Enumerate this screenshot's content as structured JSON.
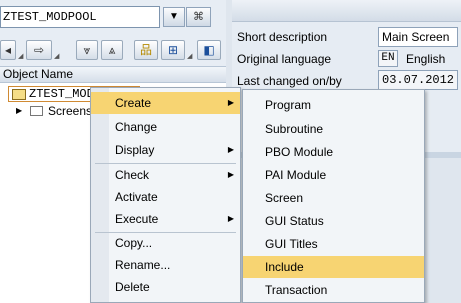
{
  "program": {
    "name": "ZTEST_MODPOOL"
  },
  "tree": {
    "header": "Object Name",
    "nodes": [
      {
        "label": "ZTEST_MODPOOL"
      },
      {
        "label": "Screens"
      }
    ]
  },
  "attributes": {
    "short_description_label": "Short description",
    "short_description_value": "Main Screen",
    "original_language_label": "Original language",
    "language_code": "EN",
    "language_name": "English",
    "last_changed_label": "Last changed on/by",
    "last_changed_date": "03.07.2012"
  },
  "context_menu": {
    "items": [
      {
        "label": "Create",
        "has_submenu": true
      },
      {
        "label": "Change"
      },
      {
        "label": "Display",
        "has_submenu": true
      },
      {
        "label": "Check",
        "has_submenu": true
      },
      {
        "label": "Activate"
      },
      {
        "label": "Execute",
        "has_submenu": true
      },
      {
        "label": "Copy..."
      },
      {
        "label": "Rename..."
      },
      {
        "label": "Delete"
      }
    ]
  },
  "create_submenu": {
    "items": [
      {
        "label": "Program"
      },
      {
        "label": "Subroutine"
      },
      {
        "label": "PBO Module"
      },
      {
        "label": "PAI Module"
      },
      {
        "label": "Screen"
      },
      {
        "label": "GUI Status"
      },
      {
        "label": "GUI Titles"
      },
      {
        "label": "Include"
      },
      {
        "label": "Transaction"
      }
    ]
  },
  "highlight_color": "#f7d472"
}
